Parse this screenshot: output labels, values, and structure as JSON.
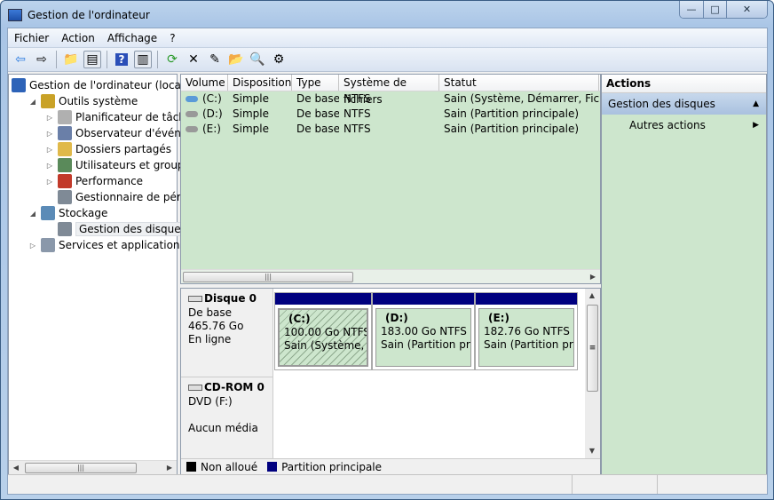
{
  "window": {
    "title": "Gestion de l'ordinateur",
    "minimize": "—",
    "maximize": "□",
    "close": "✕"
  },
  "menu": [
    "Fichier",
    "Action",
    "Affichage",
    "?"
  ],
  "toolbar": [
    {
      "icon": "back-arrow-icon",
      "glyph": "⇦"
    },
    {
      "icon": "forward-arrow-icon",
      "glyph": "⇨"
    },
    {
      "icon": "up-folder-icon",
      "glyph": "📁"
    },
    {
      "icon": "show-hide-tree-icon",
      "glyph": "▤"
    },
    {
      "icon": "help-icon",
      "glyph": "?"
    },
    {
      "icon": "show-hide-action-pane-icon",
      "glyph": "▥"
    },
    {
      "icon": "refresh-icon",
      "glyph": "⟳"
    },
    {
      "icon": "delete-icon",
      "glyph": "✕"
    },
    {
      "icon": "properties-icon",
      "glyph": "✎"
    },
    {
      "icon": "open-folder-icon",
      "glyph": "📂"
    },
    {
      "icon": "search-icon",
      "glyph": "🔍"
    },
    {
      "icon": "settings-icon",
      "glyph": "⚙"
    }
  ],
  "tree": [
    {
      "label": "Gestion de l'ordinateur (local)",
      "level": 0,
      "expander": "",
      "color": "#2d63b8"
    },
    {
      "label": "Outils système",
      "level": 1,
      "expander": "◢",
      "color": "#c9a227"
    },
    {
      "label": "Planificateur de tâches",
      "level": 2,
      "expander": "▷",
      "color": "#b0b0b0"
    },
    {
      "label": "Observateur d'événeme",
      "level": 2,
      "expander": "▷",
      "color": "#6a7fa8"
    },
    {
      "label": "Dossiers partagés",
      "level": 2,
      "expander": "▷",
      "color": "#e0b94a"
    },
    {
      "label": "Utilisateurs et groupes l",
      "level": 2,
      "expander": "▷",
      "color": "#5a8a5a"
    },
    {
      "label": "Performance",
      "level": 2,
      "expander": "▷",
      "color": "#c23a2a"
    },
    {
      "label": "Gestionnaire de périphé",
      "level": 2,
      "expander": "",
      "color": "#7f8a96"
    },
    {
      "label": "Stockage",
      "level": 1,
      "expander": "◢",
      "color": "#5b8bb7"
    },
    {
      "label": "Gestion des disques",
      "level": 2,
      "expander": "",
      "color": "#7f8a96",
      "selected": true
    },
    {
      "label": "Services et applications",
      "level": 1,
      "expander": "▷",
      "color": "#8a98aa"
    }
  ],
  "volumes": {
    "columns": [
      "Volume",
      "Disposition",
      "Type",
      "Système de fichiers",
      "Statut"
    ],
    "rows": [
      [
        "(C:)",
        "Simple",
        "De base",
        "NTFS",
        "Sain (Système, Démarrer, Fichier"
      ],
      [
        "(D:)",
        "Simple",
        "De base",
        "NTFS",
        "Sain (Partition principale)"
      ],
      [
        "(E:)",
        "Simple",
        "De base",
        "NTFS",
        "Sain (Partition principale)"
      ]
    ]
  },
  "disks": [
    {
      "name": "Disque 0",
      "type": "De base",
      "size": "465.76 Go",
      "state": "En ligne",
      "partitions": [
        {
          "label": "(C:)",
          "size": "100.00 Go NTFS",
          "status": "Sain (Système, Dé",
          "selected": true
        },
        {
          "label": "(D:)",
          "size": "183.00 Go NTFS",
          "status": "Sain (Partition prin"
        },
        {
          "label": "(E:)",
          "size": "182.76 Go NTFS",
          "status": "Sain (Partition princ"
        }
      ]
    },
    {
      "name": "CD-ROM 0",
      "type": "DVD (F:)",
      "size": "",
      "state": "Aucun média"
    }
  ],
  "legend": [
    {
      "label": "Non alloué",
      "color": "#000000"
    },
    {
      "label": "Partition principale",
      "color": "#00007f"
    }
  ],
  "actions": {
    "title": "Actions",
    "section": "Gestion des disques",
    "item": "Autres actions"
  },
  "colors": {
    "pane_green": "#cde6cd",
    "primary_partition": "#00007f"
  }
}
